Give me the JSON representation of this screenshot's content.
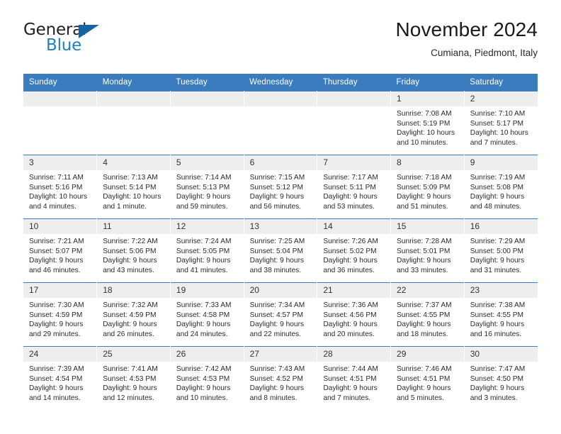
{
  "brand": {
    "name_part1": "General",
    "name_part2": "Blue",
    "accent_color": "#1f7fc4",
    "triangle_color": "#1464a5"
  },
  "header": {
    "title": "November 2024",
    "subtitle": "Cumiana, Piedmont, Italy",
    "header_bar_color": "#3a7cbd"
  },
  "weekdays": [
    "Sunday",
    "Monday",
    "Tuesday",
    "Wednesday",
    "Thursday",
    "Friday",
    "Saturday"
  ],
  "weeks": [
    [
      {
        "day": "",
        "blank": true
      },
      {
        "day": "",
        "blank": true
      },
      {
        "day": "",
        "blank": true
      },
      {
        "day": "",
        "blank": true
      },
      {
        "day": "",
        "blank": true
      },
      {
        "day": "1",
        "sunrise": "Sunrise: 7:08 AM",
        "sunset": "Sunset: 5:19 PM",
        "daylight": "Daylight: 10 hours and 10 minutes."
      },
      {
        "day": "2",
        "sunrise": "Sunrise: 7:10 AM",
        "sunset": "Sunset: 5:17 PM",
        "daylight": "Daylight: 10 hours and 7 minutes."
      }
    ],
    [
      {
        "day": "3",
        "sunrise": "Sunrise: 7:11 AM",
        "sunset": "Sunset: 5:16 PM",
        "daylight": "Daylight: 10 hours and 4 minutes."
      },
      {
        "day": "4",
        "sunrise": "Sunrise: 7:13 AM",
        "sunset": "Sunset: 5:14 PM",
        "daylight": "Daylight: 10 hours and 1 minute."
      },
      {
        "day": "5",
        "sunrise": "Sunrise: 7:14 AM",
        "sunset": "Sunset: 5:13 PM",
        "daylight": "Daylight: 9 hours and 59 minutes."
      },
      {
        "day": "6",
        "sunrise": "Sunrise: 7:15 AM",
        "sunset": "Sunset: 5:12 PM",
        "daylight": "Daylight: 9 hours and 56 minutes."
      },
      {
        "day": "7",
        "sunrise": "Sunrise: 7:17 AM",
        "sunset": "Sunset: 5:11 PM",
        "daylight": "Daylight: 9 hours and 53 minutes."
      },
      {
        "day": "8",
        "sunrise": "Sunrise: 7:18 AM",
        "sunset": "Sunset: 5:09 PM",
        "daylight": "Daylight: 9 hours and 51 minutes."
      },
      {
        "day": "9",
        "sunrise": "Sunrise: 7:19 AM",
        "sunset": "Sunset: 5:08 PM",
        "daylight": "Daylight: 9 hours and 48 minutes."
      }
    ],
    [
      {
        "day": "10",
        "sunrise": "Sunrise: 7:21 AM",
        "sunset": "Sunset: 5:07 PM",
        "daylight": "Daylight: 9 hours and 46 minutes."
      },
      {
        "day": "11",
        "sunrise": "Sunrise: 7:22 AM",
        "sunset": "Sunset: 5:06 PM",
        "daylight": "Daylight: 9 hours and 43 minutes."
      },
      {
        "day": "12",
        "sunrise": "Sunrise: 7:24 AM",
        "sunset": "Sunset: 5:05 PM",
        "daylight": "Daylight: 9 hours and 41 minutes."
      },
      {
        "day": "13",
        "sunrise": "Sunrise: 7:25 AM",
        "sunset": "Sunset: 5:04 PM",
        "daylight": "Daylight: 9 hours and 38 minutes."
      },
      {
        "day": "14",
        "sunrise": "Sunrise: 7:26 AM",
        "sunset": "Sunset: 5:02 PM",
        "daylight": "Daylight: 9 hours and 36 minutes."
      },
      {
        "day": "15",
        "sunrise": "Sunrise: 7:28 AM",
        "sunset": "Sunset: 5:01 PM",
        "daylight": "Daylight: 9 hours and 33 minutes."
      },
      {
        "day": "16",
        "sunrise": "Sunrise: 7:29 AM",
        "sunset": "Sunset: 5:00 PM",
        "daylight": "Daylight: 9 hours and 31 minutes."
      }
    ],
    [
      {
        "day": "17",
        "sunrise": "Sunrise: 7:30 AM",
        "sunset": "Sunset: 4:59 PM",
        "daylight": "Daylight: 9 hours and 29 minutes."
      },
      {
        "day": "18",
        "sunrise": "Sunrise: 7:32 AM",
        "sunset": "Sunset: 4:59 PM",
        "daylight": "Daylight: 9 hours and 26 minutes."
      },
      {
        "day": "19",
        "sunrise": "Sunrise: 7:33 AM",
        "sunset": "Sunset: 4:58 PM",
        "daylight": "Daylight: 9 hours and 24 minutes."
      },
      {
        "day": "20",
        "sunrise": "Sunrise: 7:34 AM",
        "sunset": "Sunset: 4:57 PM",
        "daylight": "Daylight: 9 hours and 22 minutes."
      },
      {
        "day": "21",
        "sunrise": "Sunrise: 7:36 AM",
        "sunset": "Sunset: 4:56 PM",
        "daylight": "Daylight: 9 hours and 20 minutes."
      },
      {
        "day": "22",
        "sunrise": "Sunrise: 7:37 AM",
        "sunset": "Sunset: 4:55 PM",
        "daylight": "Daylight: 9 hours and 18 minutes."
      },
      {
        "day": "23",
        "sunrise": "Sunrise: 7:38 AM",
        "sunset": "Sunset: 4:55 PM",
        "daylight": "Daylight: 9 hours and 16 minutes."
      }
    ],
    [
      {
        "day": "24",
        "sunrise": "Sunrise: 7:39 AM",
        "sunset": "Sunset: 4:54 PM",
        "daylight": "Daylight: 9 hours and 14 minutes."
      },
      {
        "day": "25",
        "sunrise": "Sunrise: 7:41 AM",
        "sunset": "Sunset: 4:53 PM",
        "daylight": "Daylight: 9 hours and 12 minutes."
      },
      {
        "day": "26",
        "sunrise": "Sunrise: 7:42 AM",
        "sunset": "Sunset: 4:53 PM",
        "daylight": "Daylight: 9 hours and 10 minutes."
      },
      {
        "day": "27",
        "sunrise": "Sunrise: 7:43 AM",
        "sunset": "Sunset: 4:52 PM",
        "daylight": "Daylight: 9 hours and 8 minutes."
      },
      {
        "day": "28",
        "sunrise": "Sunrise: 7:44 AM",
        "sunset": "Sunset: 4:51 PM",
        "daylight": "Daylight: 9 hours and 7 minutes."
      },
      {
        "day": "29",
        "sunrise": "Sunrise: 7:46 AM",
        "sunset": "Sunset: 4:51 PM",
        "daylight": "Daylight: 9 hours and 5 minutes."
      },
      {
        "day": "30",
        "sunrise": "Sunrise: 7:47 AM",
        "sunset": "Sunset: 4:50 PM",
        "daylight": "Daylight: 9 hours and 3 minutes."
      }
    ]
  ]
}
